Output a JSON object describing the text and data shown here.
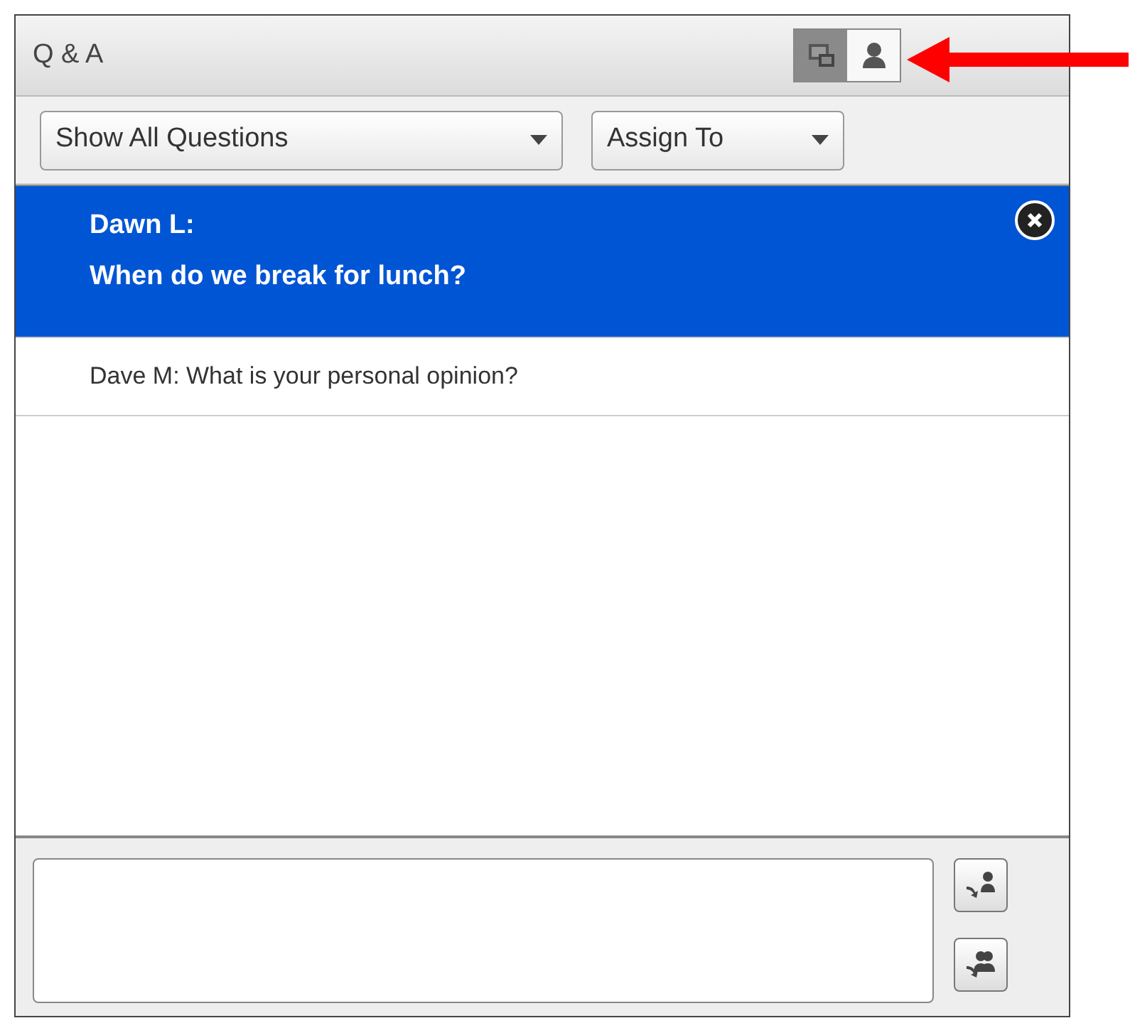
{
  "panel": {
    "title": "Q & A"
  },
  "view_toggle": [
    {
      "kind": "presenter",
      "selected": true
    },
    {
      "kind": "participant",
      "selected": false
    }
  ],
  "filters": [
    {
      "label": "Show All Questions"
    },
    {
      "label": "Assign To"
    }
  ],
  "questions": [
    {
      "name": "Dawn L:",
      "text": "When do we break for lunch?",
      "selected": true
    },
    {
      "name": "Dave M:",
      "text": "What is your personal opinion?",
      "selected": false
    }
  ],
  "answer_buttons": [
    {
      "kind": "send-one"
    },
    {
      "kind": "send-all"
    }
  ]
}
